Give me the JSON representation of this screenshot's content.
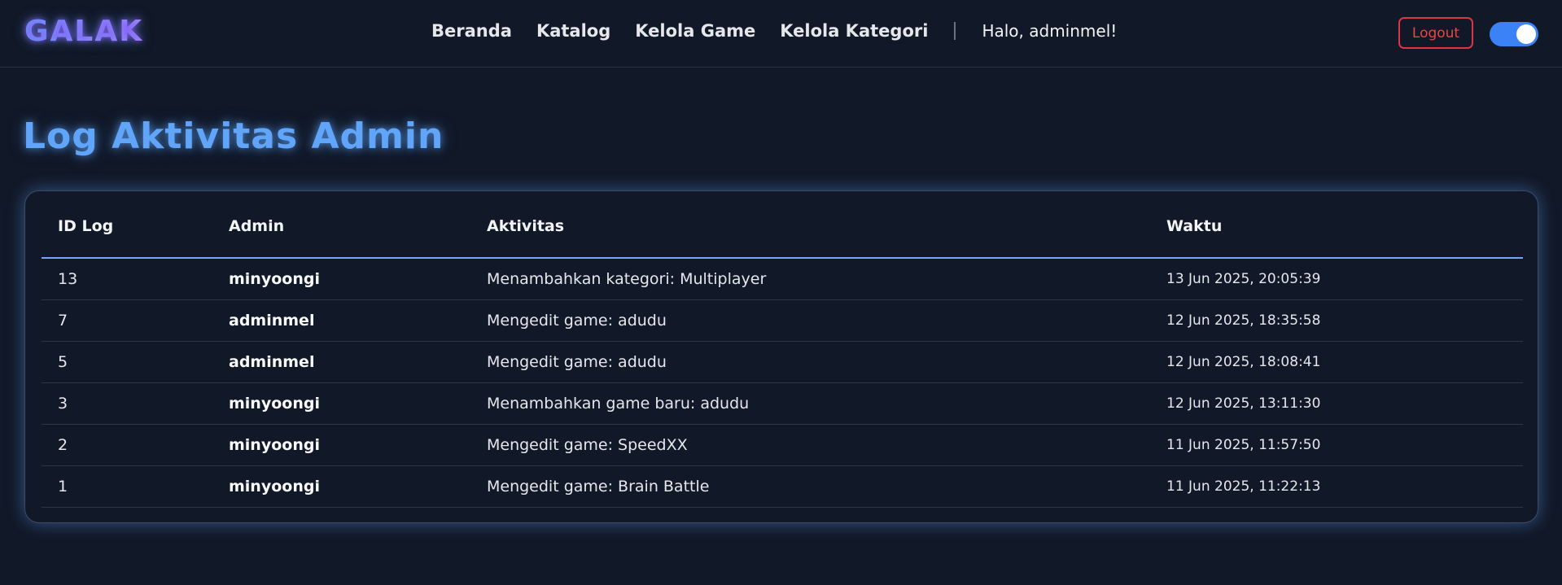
{
  "brand": {
    "logo": "GALAK"
  },
  "nav": {
    "links": [
      "Beranda",
      "Katalog",
      "Kelola Game",
      "Kelola Kategori"
    ],
    "greeting": "Halo, adminmel!",
    "logout": "Logout",
    "theme_toggle": "on"
  },
  "page": {
    "title": "Log Aktivitas Admin"
  },
  "table": {
    "headers": [
      "ID Log",
      "Admin",
      "Aktivitas",
      "Waktu"
    ],
    "rows": [
      {
        "id": "13",
        "admin": "minyoongi",
        "activity": "Menambahkan kategori: Multiplayer",
        "time": "13 Jun 2025, 20:05:39"
      },
      {
        "id": "7",
        "admin": "adminmel",
        "activity": "Mengedit game: adudu",
        "time": "12 Jun 2025, 18:35:58"
      },
      {
        "id": "5",
        "admin": "adminmel",
        "activity": "Mengedit game: adudu",
        "time": "12 Jun 2025, 18:08:41"
      },
      {
        "id": "3",
        "admin": "minyoongi",
        "activity": "Menambahkan game baru: adudu",
        "time": "12 Jun 2025, 13:11:30"
      },
      {
        "id": "2",
        "admin": "minyoongi",
        "activity": "Mengedit game: SpeedXX",
        "time": "11 Jun 2025, 11:57:50"
      },
      {
        "id": "1",
        "admin": "minyoongi",
        "activity": "Mengedit game: Brain Battle",
        "time": "11 Jun 2025, 11:22:13"
      }
    ]
  },
  "colors": {
    "background": "#111827",
    "accent": "#60a5fa",
    "logout": "#dc3545",
    "toggle": "#3b82f6"
  }
}
